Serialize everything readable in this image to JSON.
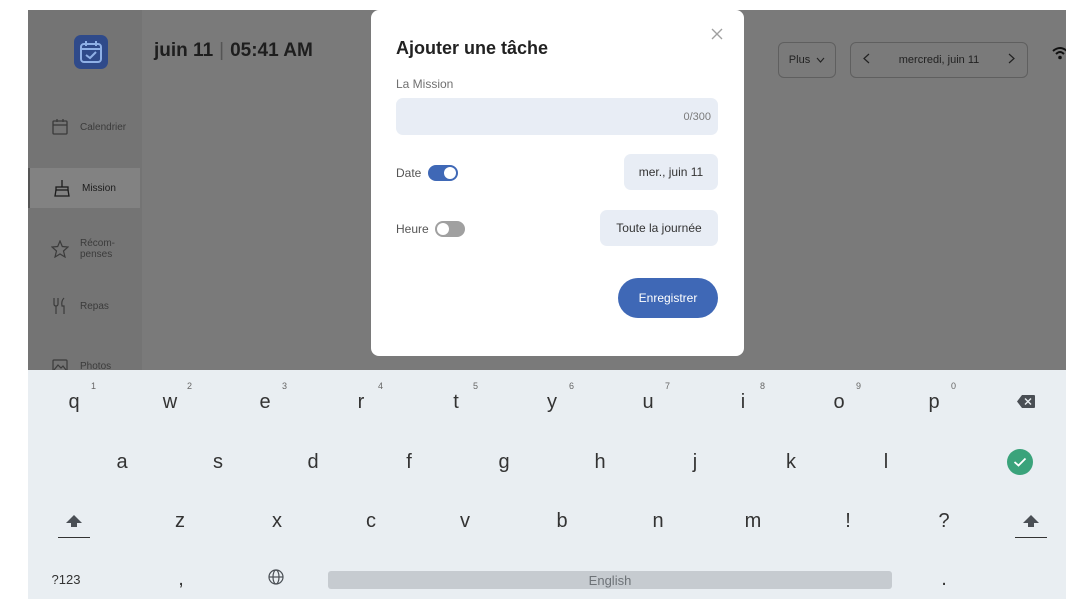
{
  "header": {
    "date": "juin 11",
    "time": "05:41 AM",
    "more_label": "Plus",
    "current_day": "mercredi, juin 11"
  },
  "sidebar": {
    "items": [
      {
        "label": "Calendrier",
        "icon": "calendar-icon",
        "active": false
      },
      {
        "label": "Mission",
        "icon": "broom-icon",
        "active": true
      },
      {
        "label": "Récom-",
        "label2": "penses",
        "icon": "star-icon",
        "active": false
      },
      {
        "label": "Repas",
        "icon": "utensils-icon",
        "active": false
      },
      {
        "label": "Photos",
        "icon": "photo-icon",
        "active": false
      }
    ]
  },
  "modal": {
    "title": "Ajouter une tâche",
    "mission_label": "La Mission",
    "mission_value": "",
    "mission_count": "0/300",
    "date_label": "Date",
    "date_enabled": true,
    "date_value": "mer., juin 11",
    "time_label": "Heure",
    "time_enabled": false,
    "time_value": "Toute la journée",
    "save_label": "Enregistrer"
  },
  "keyboard": {
    "row1": [
      {
        "k": "q",
        "h": "1"
      },
      {
        "k": "w",
        "h": "2"
      },
      {
        "k": "e",
        "h": "3"
      },
      {
        "k": "r",
        "h": "4"
      },
      {
        "k": "t",
        "h": "5"
      },
      {
        "k": "y",
        "h": "6"
      },
      {
        "k": "u",
        "h": "7"
      },
      {
        "k": "i",
        "h": "8"
      },
      {
        "k": "o",
        "h": "9"
      },
      {
        "k": "p",
        "h": "0"
      }
    ],
    "row2": [
      "a",
      "s",
      "d",
      "f",
      "g",
      "h",
      "j",
      "k",
      "l"
    ],
    "row3": [
      "z",
      "x",
      "c",
      "v",
      "b",
      "n",
      "m",
      "!",
      "?"
    ],
    "symbols_label": "?123",
    "comma_label": ",",
    "space_label": "English",
    "period_label": "."
  },
  "colors": {
    "accent": "#3f68b6",
    "confirm": "#3aa37b",
    "overlay": "#7a7a7a",
    "keyboard_bg": "#e9eef2"
  }
}
